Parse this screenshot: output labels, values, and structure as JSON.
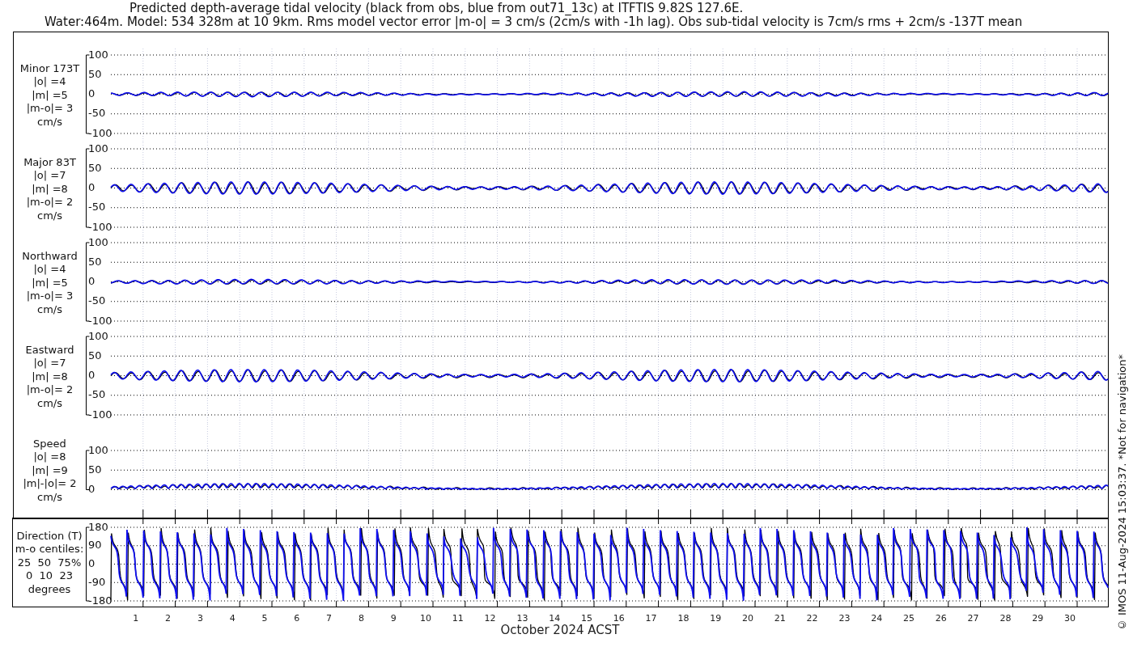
{
  "title_lines": [
    "Predicted depth-average tidal velocity (black from obs, blue from out71_13c) at ITFTIS 9.82S 127.6E.",
    "Water:464m. Model: 534 328m at 10 9km. Rms model vector error |m-o| = 3 cm/s (2cm/s with -1h lag). Obs sub-tidal velocity is 7cm/s rms + 2cm/s -137T mean"
  ],
  "panels": [
    {
      "kind": "minor",
      "label_lines": [
        "Minor 173T",
        "|o| =4",
        "|m| =5",
        "|m-o|= 3",
        "cm/s"
      ],
      "yticks": [
        "100",
        "50",
        "0",
        "-50",
        "-100"
      ]
    },
    {
      "kind": "major",
      "label_lines": [
        "Major 83T",
        "|o| =7",
        "|m| =8",
        "|m-o|= 2",
        "cm/s"
      ],
      "yticks": [
        "100",
        "50",
        "0",
        "-50",
        "-100"
      ]
    },
    {
      "kind": "north",
      "label_lines": [
        "Northward",
        "|o| =4",
        "|m| =5",
        "|m-o|= 3",
        "cm/s"
      ],
      "yticks": [
        "100",
        "50",
        "0",
        "-50",
        "-100"
      ]
    },
    {
      "kind": "east",
      "label_lines": [
        "Eastward",
        "|o| =7",
        "|m| =8",
        "|m-o|= 2",
        "cm/s"
      ],
      "yticks": [
        "100",
        "50",
        "0",
        "-50",
        "-100"
      ]
    },
    {
      "kind": "speed",
      "label_lines": [
        "Speed",
        "|o| =8",
        "|m| =9",
        "|m|-|o|= 2",
        "cm/s"
      ],
      "yticks": [
        "100",
        "50",
        "0"
      ]
    }
  ],
  "direction_panel": {
    "kind": "direction",
    "label_lines": [
      "Direction (T)",
      "m-o centiles:",
      "25  50  75%",
      "0  10  23",
      "degrees"
    ],
    "yticks": [
      "180",
      "90",
      "0",
      "-90",
      "-180"
    ]
  },
  "day_labels": [
    "1",
    "2",
    "3",
    "4",
    "5",
    "6",
    "7",
    "8",
    "9",
    "10",
    "11",
    "12",
    "13",
    "14",
    "15",
    "16",
    "17",
    "18",
    "19",
    "20",
    "21",
    "22",
    "23",
    "24",
    "25",
    "26",
    "27",
    "28",
    "29",
    "30"
  ],
  "xlabel": "October 2024 ACST",
  "credit": "© IMOS 11-Aug-2024 15:03:37. *Not for navigation*"
}
